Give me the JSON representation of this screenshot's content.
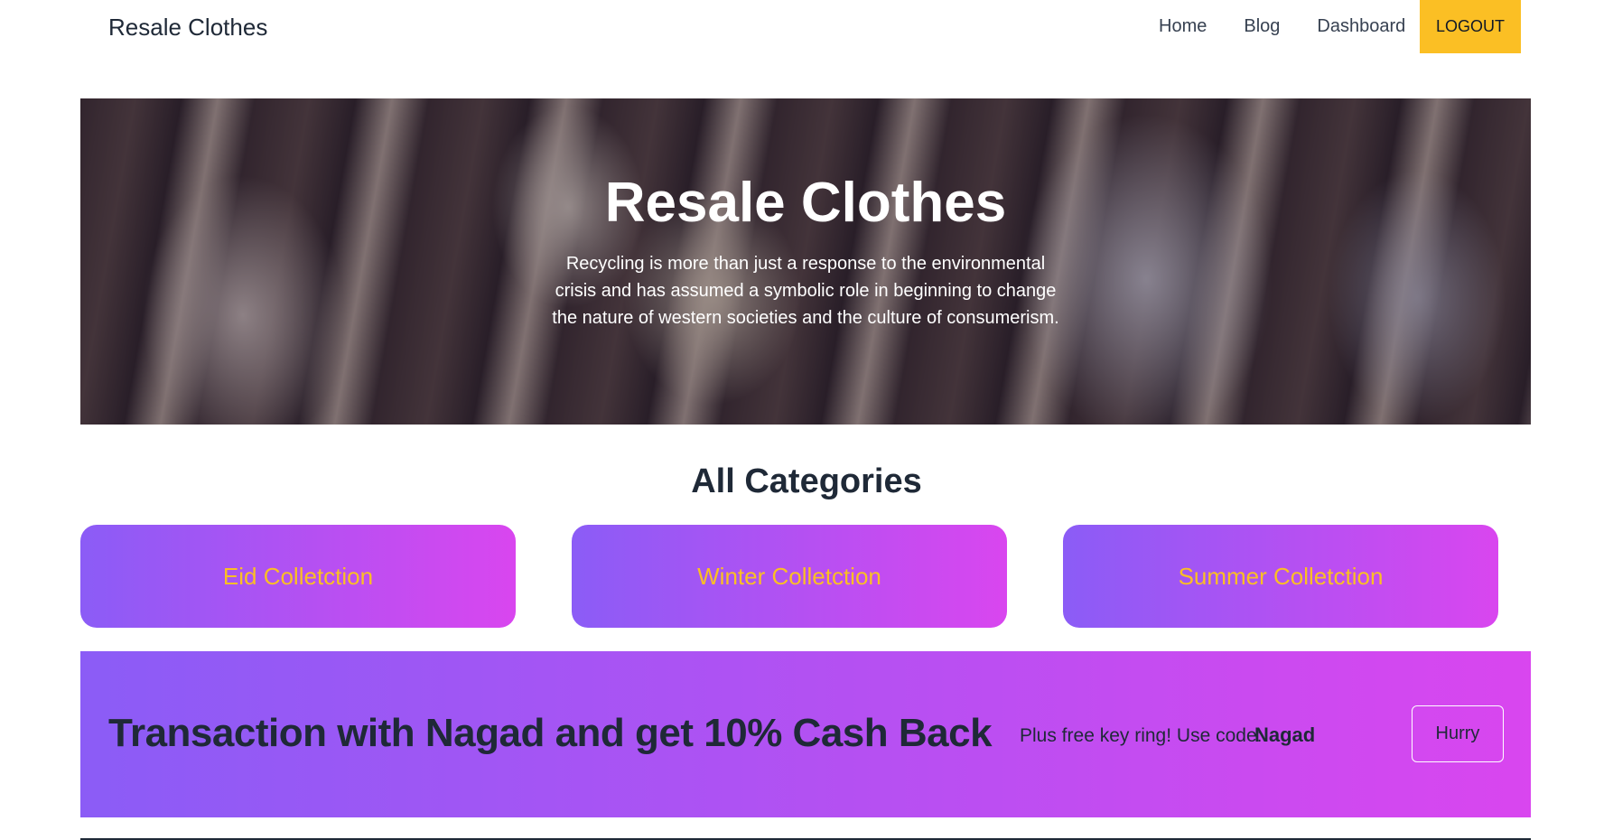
{
  "navbar": {
    "brand": "Resale Clothes",
    "links": [
      {
        "label": "Home"
      },
      {
        "label": "Blog"
      },
      {
        "label": "Dashboard"
      }
    ],
    "logout_label": "LOGOUT"
  },
  "hero": {
    "title": "Resale Clothes",
    "text": "Recycling is more than just a response to the environmental crisis and has assumed a symbolic role in beginning to change the nature of western societies and the culture of consumerism."
  },
  "categories": {
    "heading": "All Categories",
    "items": [
      {
        "label": "Eid Colletction"
      },
      {
        "label": "Winter Colletction"
      },
      {
        "label": "Summer Colletction"
      }
    ]
  },
  "promo": {
    "title": "Transaction with Nagad and get 10% Cash Back",
    "code_text": "Plus free key ring! Use code:",
    "code": "Nagad",
    "button_label": "Hurry"
  },
  "colors": {
    "accent": "#fbbf24",
    "gradient_start": "#8b5cf6",
    "gradient_end": "#d946ef"
  }
}
